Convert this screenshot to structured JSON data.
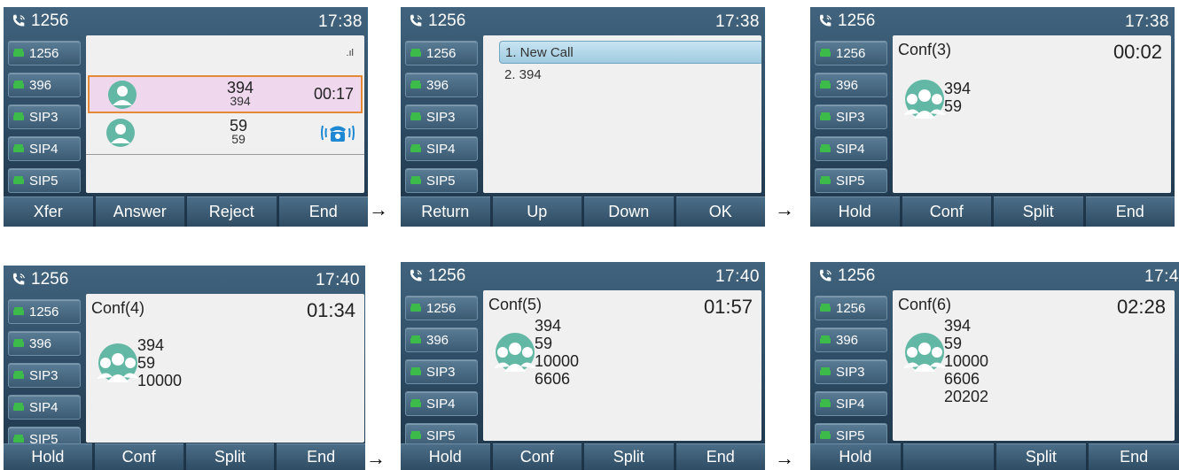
{
  "colors": {
    "highlight_bg": "#efd7ee",
    "highlight_border": "#e48a36",
    "menu_sel": "#b6d9ea",
    "avatar": "#63b7a5",
    "ring_icon": "#1e88d2"
  },
  "arrow": "→",
  "screens": [
    {
      "ext": "1256",
      "clock": "17:38",
      "lines": [
        "1256",
        "396",
        "SIP3",
        "SIP4",
        "SIP5"
      ],
      "signal": ".ıl",
      "calls": [
        {
          "n1": "394",
          "n2": "394",
          "right": "00:17"
        },
        {
          "n1": "59",
          "n2": "59",
          "right_icon": "ringing-phone-icon"
        }
      ],
      "softkeys": [
        "Xfer",
        "Answer",
        "Reject",
        "End"
      ]
    },
    {
      "ext": "1256",
      "clock": "17:38",
      "lines": [
        "1256",
        "396",
        "SIP3",
        "SIP4",
        "SIP5"
      ],
      "menu": [
        "1. New Call",
        "2. 394"
      ],
      "softkeys": [
        "Return",
        "Up",
        "Down",
        "OK"
      ]
    },
    {
      "ext": "1256",
      "clock": "17:38",
      "lines": [
        "1256",
        "396",
        "SIP3",
        "SIP4",
        "SIP5"
      ],
      "conf": {
        "title": "Conf(3)",
        "timer": "00:02",
        "members": [
          "394",
          "59"
        ]
      },
      "softkeys": [
        "Hold",
        "Conf",
        "Split",
        "End"
      ]
    },
    {
      "ext": "1256",
      "clock": "17:40",
      "lines": [
        "1256",
        "396",
        "SIP3",
        "SIP4",
        "SIP5"
      ],
      "conf": {
        "title": "Conf(4)",
        "timer": "01:34",
        "members": [
          "394",
          "59",
          "10000"
        ]
      },
      "softkeys": [
        "Hold",
        "Conf",
        "Split",
        "End"
      ]
    },
    {
      "ext": "1256",
      "clock": "17:40",
      "lines": [
        "1256",
        "396",
        "SIP3",
        "SIP4",
        "SIP5"
      ],
      "conf": {
        "title": "Conf(5)",
        "timer": "01:57",
        "members": [
          "394",
          "59",
          "10000",
          "6606"
        ]
      },
      "softkeys": [
        "Hold",
        "Conf",
        "Split",
        "End"
      ]
    },
    {
      "ext": "1256",
      "clock": "17:4",
      "lines": [
        "1256",
        "396",
        "SIP3",
        "SIP4",
        "SIP5"
      ],
      "conf": {
        "title": "Conf(6)",
        "timer": "02:28",
        "members": [
          "394",
          "59",
          "10000",
          "6606",
          "20202"
        ]
      },
      "softkeys": [
        "Hold",
        "",
        "Split",
        "End"
      ]
    }
  ]
}
